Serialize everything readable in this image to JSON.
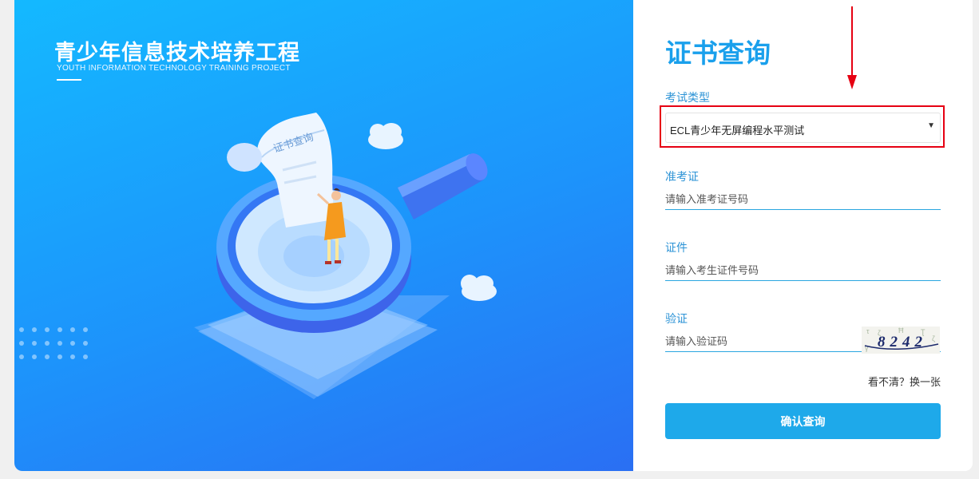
{
  "brand": {
    "title": "青少年信息技术培养工程",
    "subtitle": "YOUTH INFORMATION TECHNOLOGY TRAINING PROJECT"
  },
  "illustration": {
    "scroll_text": "证书查询",
    "icon": "magnifier-certificate-illustration"
  },
  "form": {
    "title": "证书查询",
    "exam_type": {
      "label": "考试类型",
      "selected": "ECL青少年无屏编程水平测试"
    },
    "ticket": {
      "label": "准考证",
      "placeholder": "请输入准考证号码"
    },
    "id_card": {
      "label": "证件",
      "placeholder": "请输入考生证件号码"
    },
    "captcha": {
      "label": "验证",
      "placeholder": "请输入验证码",
      "code": "8242"
    },
    "refresh_text": "看不清？换一张",
    "submit_label": "确认查询"
  },
  "colors": {
    "accent": "#1ea9ea",
    "highlight": "#e60012",
    "panel_gradient_start": "#14b9ff",
    "panel_gradient_end": "#2a6ff3"
  }
}
